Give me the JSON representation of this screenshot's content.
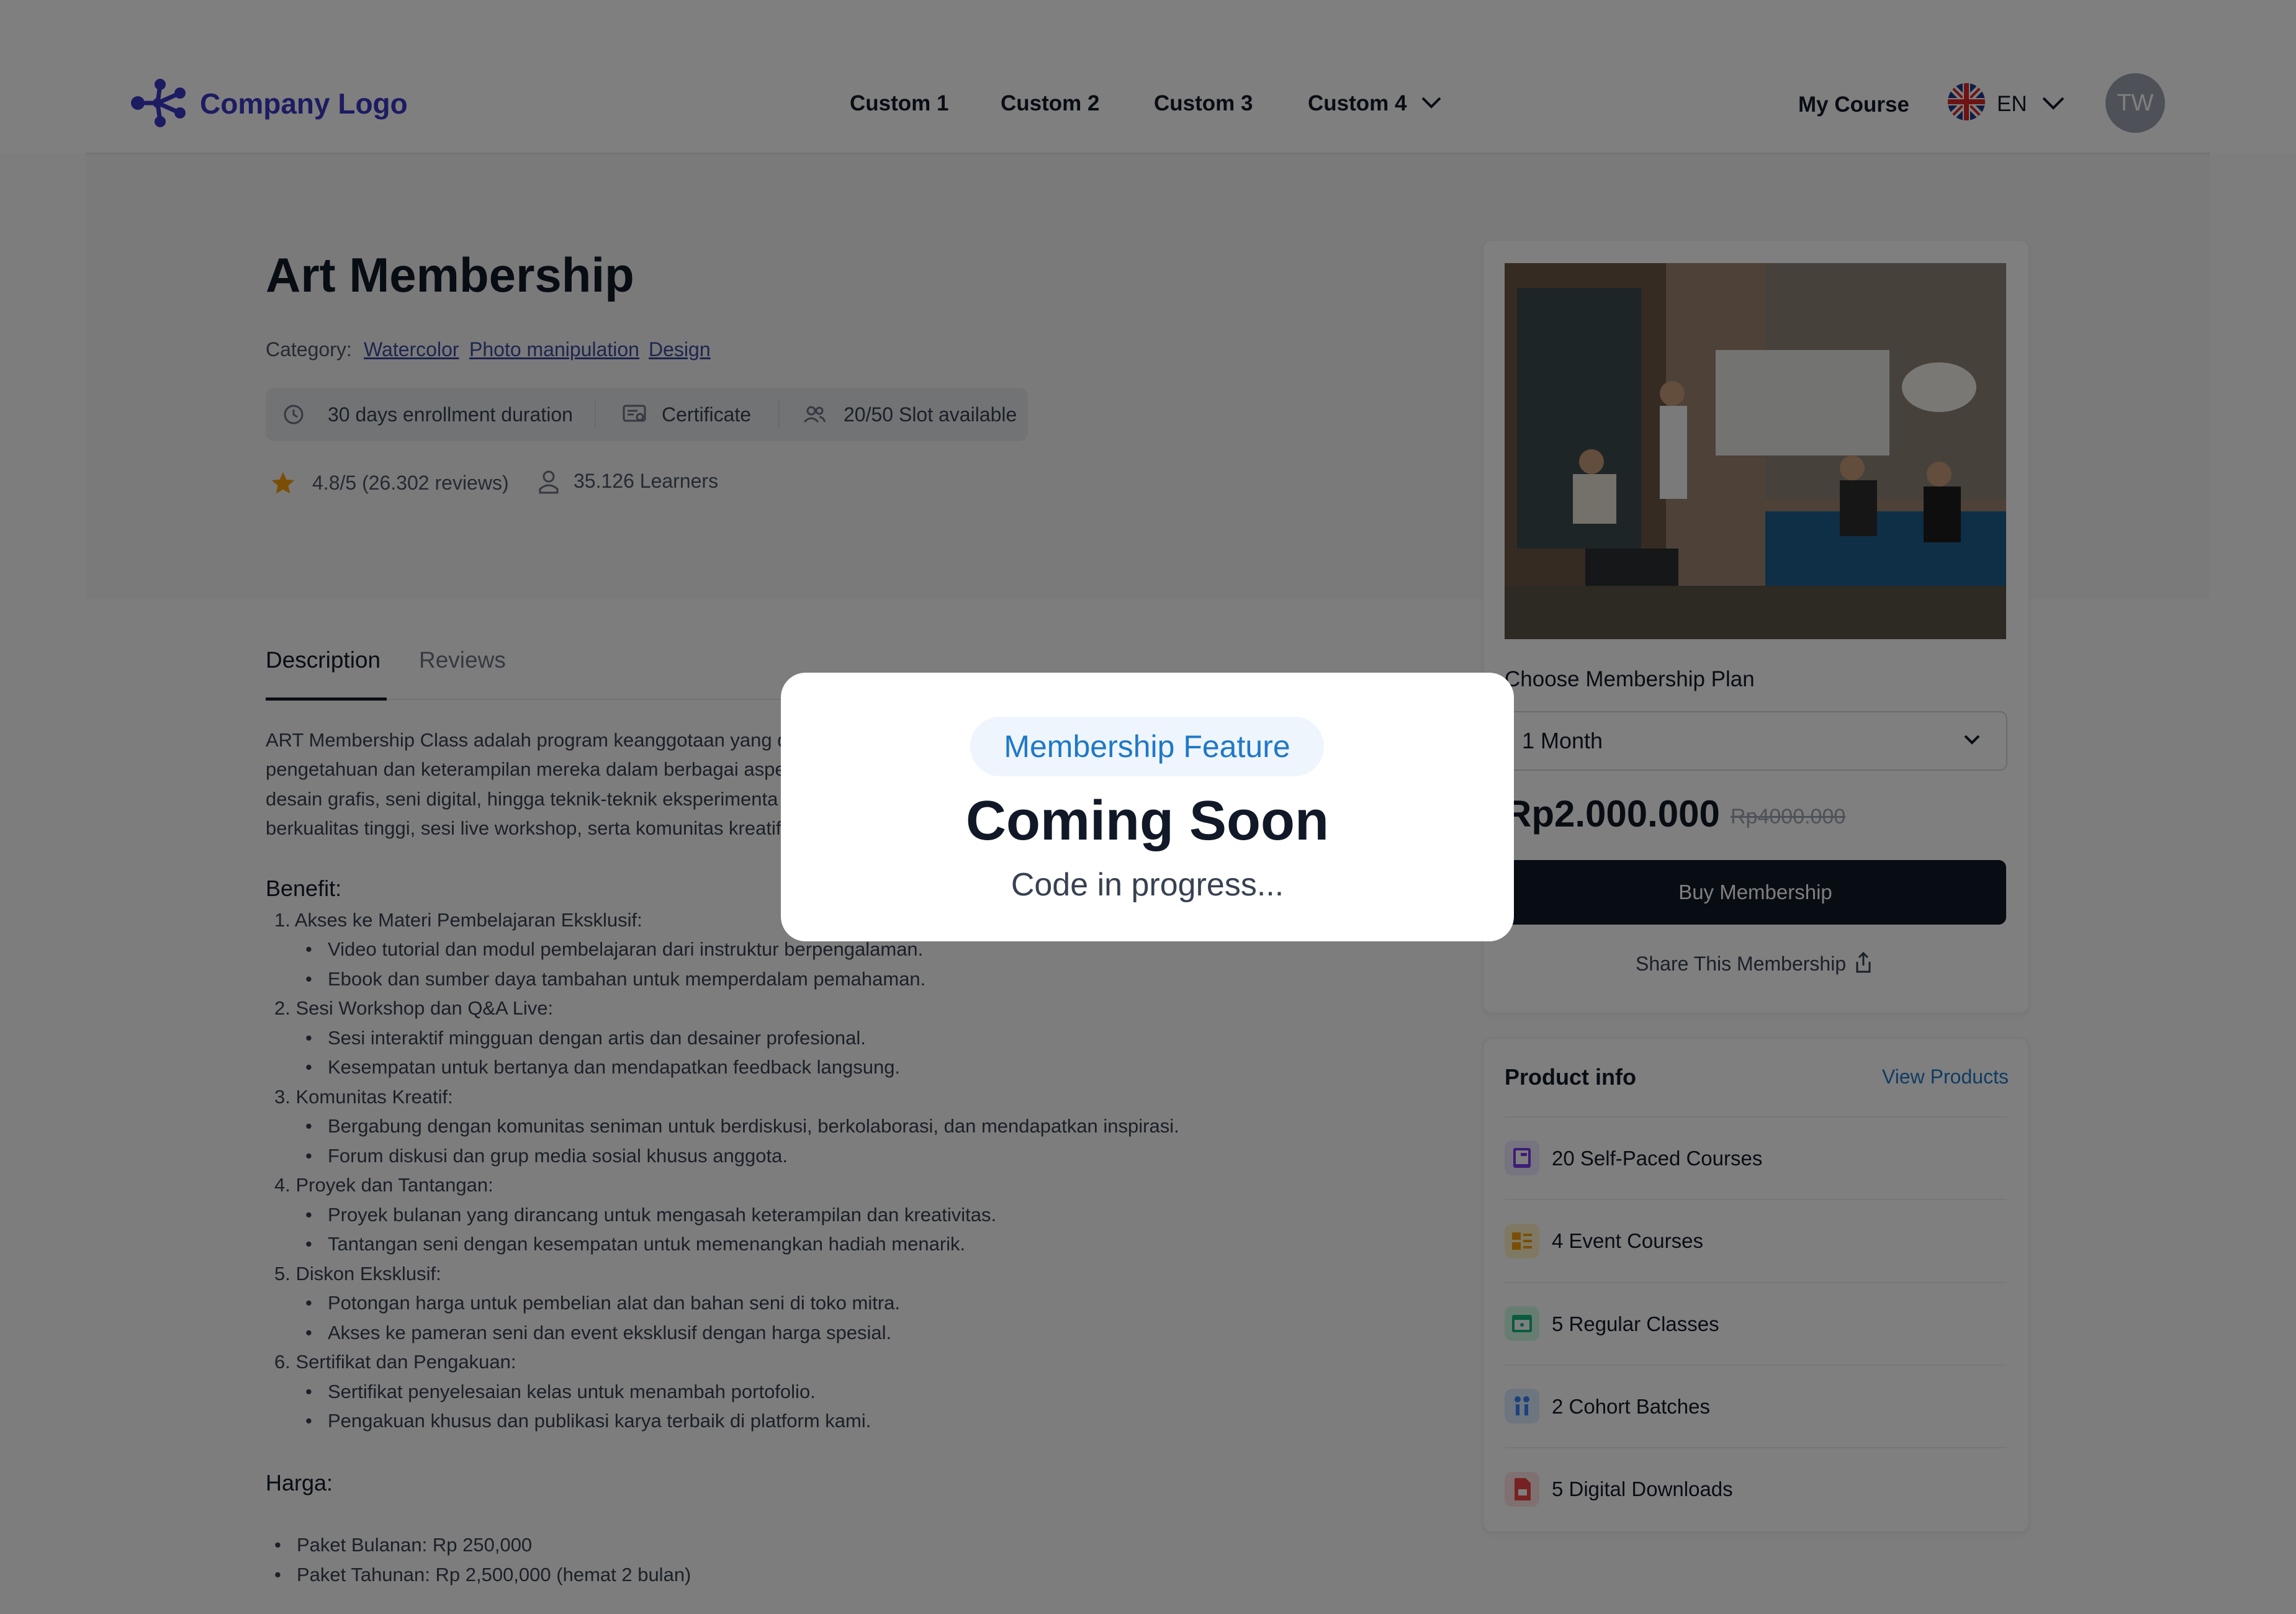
{
  "header": {
    "logo_text": "Company Logo",
    "nav": [
      "Custom 1",
      "Custom 2",
      "Custom 3",
      "Custom 4"
    ],
    "my_course": "My Course",
    "language": "EN",
    "avatar_initials": "TW"
  },
  "course": {
    "title": "Art Membership",
    "category_label": "Category:",
    "categories": [
      "Watercolor",
      "Photo manipulation",
      "Design"
    ],
    "chips": [
      "30 days enrollment duration",
      "Certificate",
      "20/50 Slot available"
    ],
    "rating": "4.8/5 (26.302 reviews)",
    "learners": "35.126 Learners"
  },
  "tabs": [
    "Description",
    "Reviews"
  ],
  "description": {
    "intro_lines": [
      "ART Membership Class adalah program keanggotaan yang d",
      "pengetahuan dan keterampilan mereka dalam berbagai aspe",
      "desain grafis, seni digital, hingga teknik-teknik eksperimenta",
      "berkualitas tinggi, sesi live workshop, serta komunitas kreatif"
    ],
    "benefit_heading": "Benefit:",
    "benefits": [
      {
        "title": "Akses ke Materi Pembelajaran Eksklusif:",
        "items": [
          "Video tutorial dan modul pembelajaran dari instruktur berpengalaman.",
          "Ebook dan sumber daya tambahan untuk memperdalam pemahaman."
        ]
      },
      {
        "title": "Sesi Workshop dan Q&A Live:",
        "items": [
          "Sesi interaktif mingguan dengan artis dan desainer profesional.",
          "Kesempatan untuk bertanya dan mendapatkan feedback langsung."
        ]
      },
      {
        "title": "Komunitas Kreatif:",
        "items": [
          "Bergabung dengan komunitas seniman untuk berdiskusi, berkolaborasi, dan mendapatkan inspirasi.",
          "Forum diskusi dan grup media sosial khusus anggota."
        ]
      },
      {
        "title": "Proyek dan Tantangan:",
        "items": [
          "Proyek bulanan yang dirancang untuk mengasah keterampilan dan kreativitas.",
          "Tantangan seni dengan kesempatan untuk memenangkan hadiah menarik."
        ]
      },
      {
        "title": "Diskon Eksklusif:",
        "items": [
          "Potongan harga untuk pembelian alat dan bahan seni di toko mitra.",
          "Akses ke pameran seni dan event eksklusif dengan harga spesial."
        ]
      },
      {
        "title": "Sertifikat dan Pengakuan:",
        "items": [
          "Sertifikat penyelesaian kelas untuk menambah portofolio.",
          "Pengakuan khusus dan publikasi karya terbaik di platform kami."
        ]
      }
    ],
    "price_heading": "Harga:",
    "prices": [
      "Paket Bulanan: Rp 250,000",
      "Paket Tahunan: Rp 2,500,000 (hemat 2 bulan)"
    ]
  },
  "purchase": {
    "plan_label": "Choose Membership Plan",
    "plan_selected": "1 Month",
    "price": "Rp2.000.000",
    "old_price": "Rp4000.000",
    "buy_label": "Buy Membership",
    "share_label": "Share This Membership"
  },
  "product_info": {
    "title": "Product info",
    "view_link": "View Products",
    "items": [
      "20 Self-Paced Courses",
      "4 Event Courses",
      "5 Regular Classes",
      "2 Cohort Batches",
      "5 Digital Downloads"
    ]
  },
  "modal": {
    "badge": "Membership Feature",
    "title": "Coming Soon",
    "subtitle": "Code in progress..."
  },
  "colors": {
    "brand": "#3b37c4",
    "accent_blue": "#1f78c7",
    "dark_button": "#111827",
    "star": "#f59e0b"
  }
}
